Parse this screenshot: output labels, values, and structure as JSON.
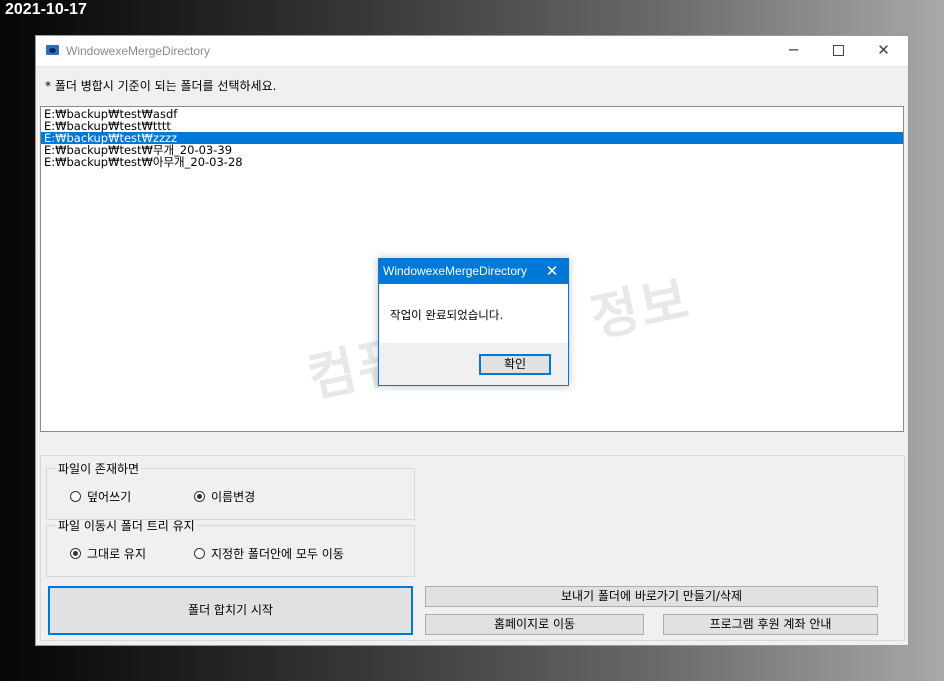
{
  "date_stamp": "2021-10-17",
  "window": {
    "title": "WindowexeMergeDirectory",
    "minimize_glyph": "─",
    "close_glyph": "✕"
  },
  "instruction": "* 폴더 병합시 기준이 되는 폴더를 선택하세요.",
  "folders": [
    "E:₩backup₩test₩asdf",
    "E:₩backup₩test₩tttt",
    "E:₩backup₩test₩zzzz",
    "E:₩backup₩test₩무개_20-03-39",
    "E:₩backup₩test₩아무개_20-03-28"
  ],
  "selected_folder_index": 2,
  "watermark": "컴퓨터 관련 정보",
  "file_exists_group": {
    "label": "파일이 존재하면",
    "options": [
      "덮어쓰기",
      "이름변경"
    ],
    "selected": "이름변경"
  },
  "tree_group": {
    "label": "파일 이동시 폴더 트리 유지",
    "options": [
      "그대로 유지",
      "지정한 폴더안에 모두 이동"
    ],
    "selected": "그대로 유지"
  },
  "buttons": {
    "start_merge": "폴더 합치기 시작",
    "sendto_shortcut": "보내기 폴더에 바로가기 만들기/삭제",
    "homepage": "홈페이지로 이동",
    "sponsor": "프로그램 후원 계좌 안내"
  },
  "dialog": {
    "title": "WindowexeMergeDirectory",
    "message": "작업이 완료되었습니다.",
    "ok": "확인",
    "close_glyph": "✕"
  },
  "colors": {
    "selection": "#0078d7",
    "dialog_title": "#0078d7",
    "window_bg": "#f0f0f0"
  }
}
